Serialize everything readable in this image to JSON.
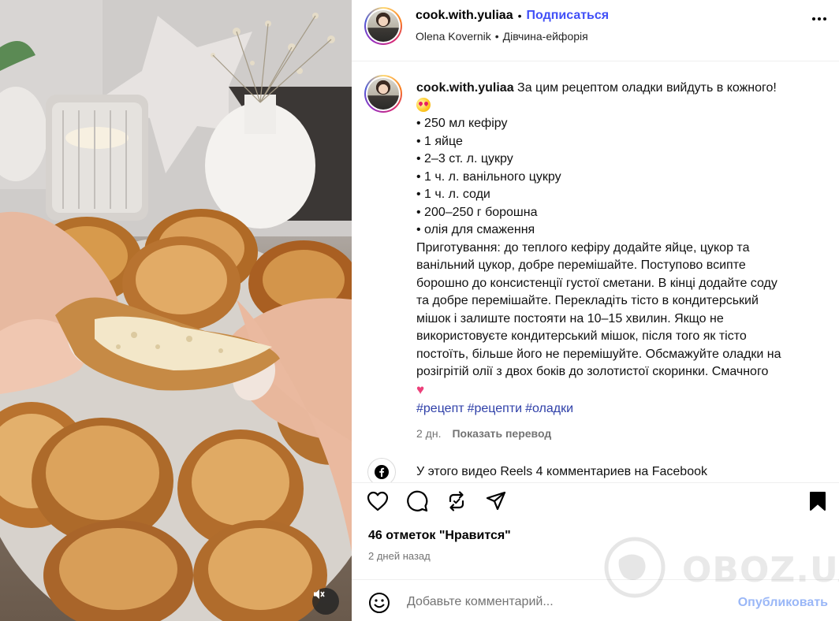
{
  "header": {
    "username": "cook.with.yuliaa",
    "separator": "•",
    "follow_label": "Подписаться",
    "audio_artist": "Olena Kovernik",
    "audio_separator": "•",
    "audio_title": "Дівчина-ейфорія"
  },
  "caption": {
    "username": "cook.with.yuliaa",
    "intro": "За цим рецептом оладки вийдуть в кожного!",
    "ingredients": [
      "• 250 мл кефіру",
      "• 1 яйце",
      "• 2–3 ст. л. цукру",
      "• 1 ч. л. ванільного цукру",
      "• 1 ч. л. соди",
      "• 200–250 г борошна",
      "• олія для смаження"
    ],
    "method_lines": [
      "Приготування: до теплого кефіру додайте яйце, цукор та",
      "ванільний цукор, добре перемішайте. Поступово всипте",
      "борошно до консистенції густої сметани. В кінці додайте соду",
      "та добре перемішайте. Перекладіть тісто в кондитерський",
      "мішок і залиште постояти на 10–15 хвилин. Якщо не",
      "використовуєте кондитерський мішок, після того як тісто",
      "постоїть, більше його не перемішуйте. Обсмажуйте оладки на",
      "розігрітій олії з двох боків до золотистої скоринки. Смачного"
    ],
    "hashtags": [
      "#рецепт",
      "#рецепти",
      "#оладки"
    ],
    "time": "2 дн.",
    "translate_label": "Показать перевод"
  },
  "facebook_notice": "У этого видео Reels 4 комментариев на Facebook",
  "likes_text": "46 отметок \"Нравится\"",
  "posted_ago": "2 дней назад",
  "comment": {
    "placeholder": "Добавьте комментарий...",
    "publish_label": "Опубликовать"
  },
  "watermark": "OBOZ.UA",
  "icons": {
    "more": "more-dots-icon",
    "like": "heart-icon",
    "comment": "comment-bubble-icon",
    "repost": "repost-icon",
    "share": "send-paper-plane-icon",
    "save": "bookmark-icon",
    "emoji": "emoji-smile-icon",
    "mute": "muted-speaker-icon",
    "facebook": "facebook-logo-icon"
  },
  "colors": {
    "link_blue": "#4150f7",
    "hashtag_blue": "#2e3fa8",
    "publish_disabled": "#9ab7f7",
    "muted_text": "#737373"
  }
}
